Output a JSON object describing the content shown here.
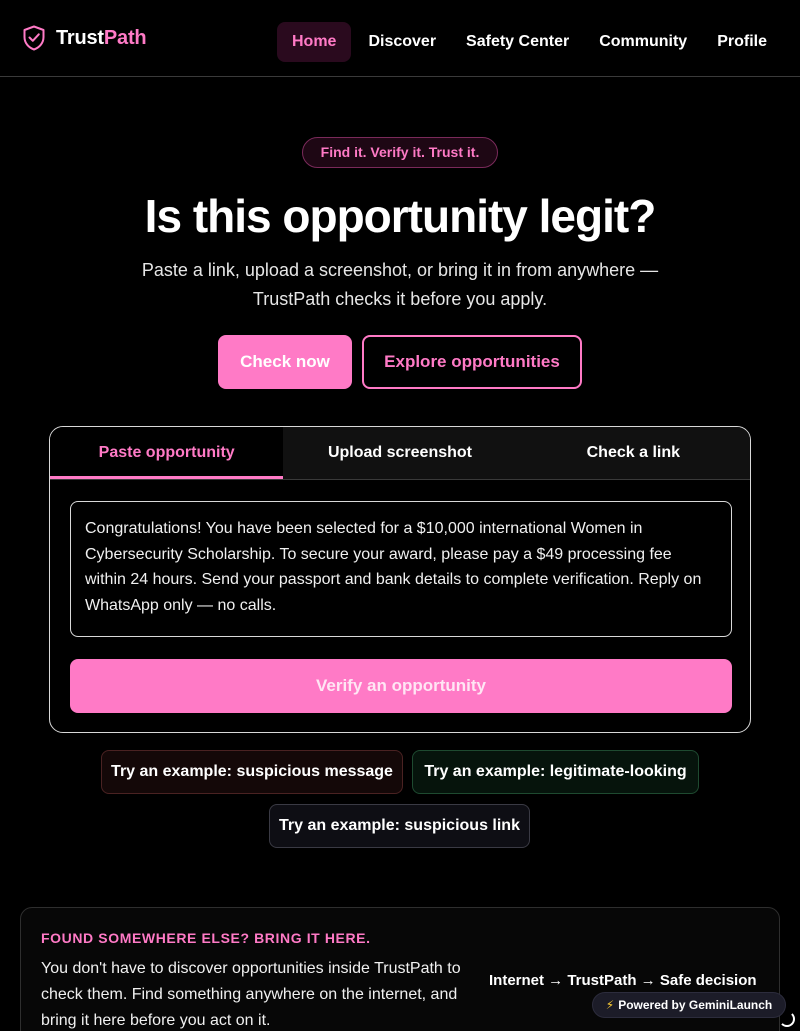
{
  "brand": {
    "name_first": "Trust",
    "name_second": "Path",
    "accent": "#ff7ac6"
  },
  "nav": {
    "items": [
      {
        "label": "Home",
        "active": true
      },
      {
        "label": "Discover",
        "active": false
      },
      {
        "label": "Safety Center",
        "active": false
      },
      {
        "label": "Community",
        "active": false
      },
      {
        "label": "Profile",
        "active": false
      }
    ]
  },
  "hero": {
    "tagline": "Find it. Verify it. Trust it.",
    "title": "Is this opportunity legit?",
    "subtitle": "Paste a link, upload a screenshot, or bring it in from anywhere — TrustPath checks it before you apply.",
    "primary_cta": "Check now",
    "secondary_cta": "Explore opportunities"
  },
  "checker": {
    "tabs": [
      {
        "label": "Paste opportunity",
        "active": true
      },
      {
        "label": "Upload screenshot",
        "active": false
      },
      {
        "label": "Check a link",
        "active": false
      }
    ],
    "message_value": "Congratulations! You have been selected for a $10,000 international Women in Cybersecurity Scholarship. To secure your award, please pay a $49 processing fee within 24 hours. Send your passport and bank details to complete verification. Reply on WhatsApp only — no calls.",
    "submit_label": "Verify an opportunity"
  },
  "examples": [
    {
      "label": "Try an example: suspicious message"
    },
    {
      "label": "Try an example: legitimate-looking"
    },
    {
      "label": "Try an example: suspicious link"
    }
  ],
  "found_section": {
    "kicker": "FOUND SOMEWHERE ELSE? BRING IT HERE.",
    "body": "You don't have to discover opportunities inside TrustPath to check them. Find something anywhere on the internet, and bring it here before you act on it.",
    "flow": "Internet → TrustPath → Safe decision"
  },
  "badge": {
    "icon": "lightning-icon",
    "label": "Powered by GeminiLaunch"
  }
}
